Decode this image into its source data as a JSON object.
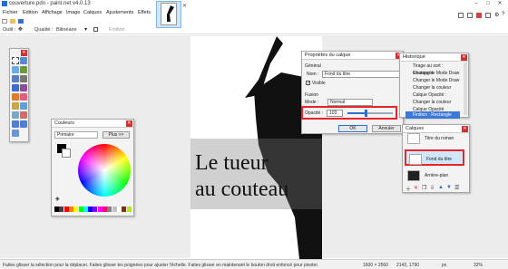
{
  "window": {
    "title": "couverture.pdn - paint.net v4.0.13",
    "minimize": "–",
    "maximize": "□",
    "close": "✕"
  },
  "menu": [
    "Fichier",
    "Edition",
    "Affichage",
    "Image",
    "Calques",
    "Ajustements",
    "Effets"
  ],
  "toolbar": {
    "tool_label": "Outil :",
    "quality_label": "Qualité :",
    "quality_value": "Bilinéaire",
    "finish_label": "Finition"
  },
  "canvas": {
    "line1": "Le tueur",
    "line2": "au couteau"
  },
  "colors_panel": {
    "title": "Couleurs",
    "primary_select": "Primaire",
    "more_button": "Plus >>",
    "palette": [
      "#000000",
      "#404040",
      "#ff0000",
      "#ff7f00",
      "#ffff00",
      "#00ff00",
      "#00ffff",
      "#0000ff",
      "#7f00ff",
      "#ff00ff",
      "#ff006e",
      "#808080",
      "#c0c0c0",
      "#ffffff",
      "#7f3300",
      "#b5e61d"
    ]
  },
  "layer_props": {
    "title": "Propriétés du calque",
    "section_general": "Général",
    "name_label": "Nom :",
    "name_value": "Fond du titre",
    "visible_label": "Visible",
    "section_fusion": "Fusion",
    "mode_label": "Mode :",
    "mode_value": "Normal",
    "opacity_label": "Opacité :",
    "opacity_value": "103",
    "opacity_fraction": 0.4,
    "ok": "OK",
    "cancel": "Annuler"
  },
  "history": {
    "title": "Historique",
    "items": [
      "Tirage au sort : Rectangle",
      "Changer le Mode Draw",
      "Changer le Mode Draw",
      "Changer la couleur",
      "Calque Opacité :",
      "Changer la couleur",
      "Calque Opacité",
      "Finition : Rectangle"
    ]
  },
  "layers": {
    "title": "Calques",
    "rows": [
      "Titre du roman",
      "Fond du titre",
      "Arrière-plan"
    ]
  },
  "status": {
    "hint": "Faites glisser la sélection pour la déplacer. Faites glisser les poignées pour ajuster l'échelle. Faites glisser en maintenant le bouton droit enfoncé pour pivoter.",
    "size": "1600 × 2560",
    "coords": "2142, 1790",
    "unit": "px",
    "zoom": "32%"
  }
}
